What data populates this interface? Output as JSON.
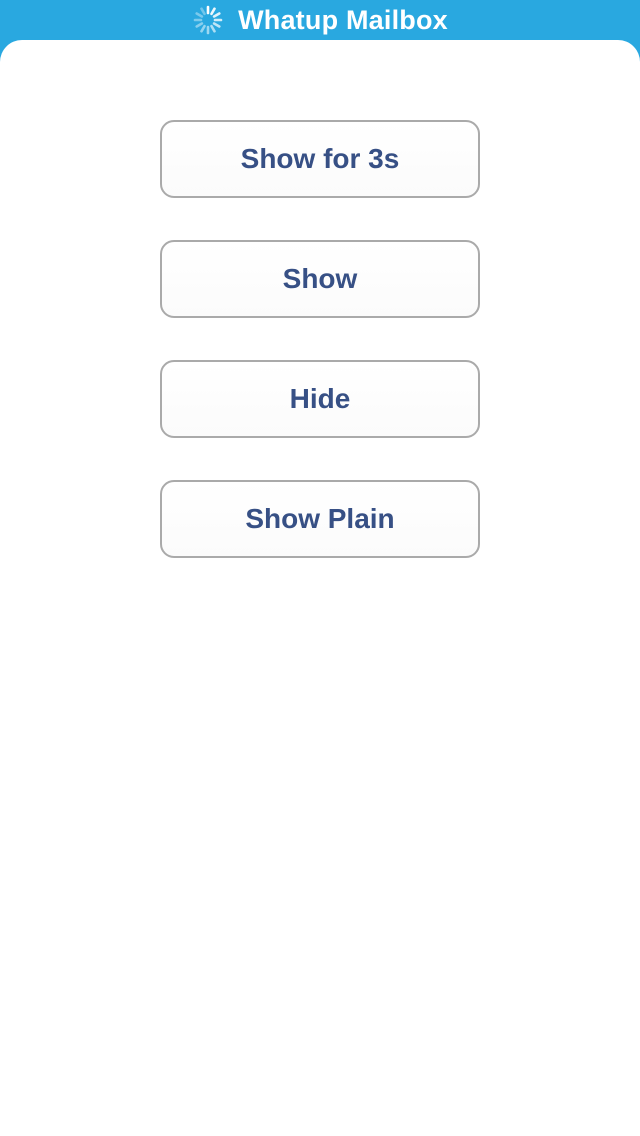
{
  "status_bar": {
    "title": "Whatup Mailbox",
    "activity_icon": "activity-spinner-icon",
    "background_color": "#29a8e0",
    "text_color": "#ffffff"
  },
  "buttons": [
    {
      "label": "Show for 3s"
    },
    {
      "label": "Show"
    },
    {
      "label": "Hide"
    },
    {
      "label": "Show Plain"
    }
  ],
  "colors": {
    "button_text": "#375085",
    "button_border": "#aaaaaa",
    "background": "#ffffff"
  }
}
